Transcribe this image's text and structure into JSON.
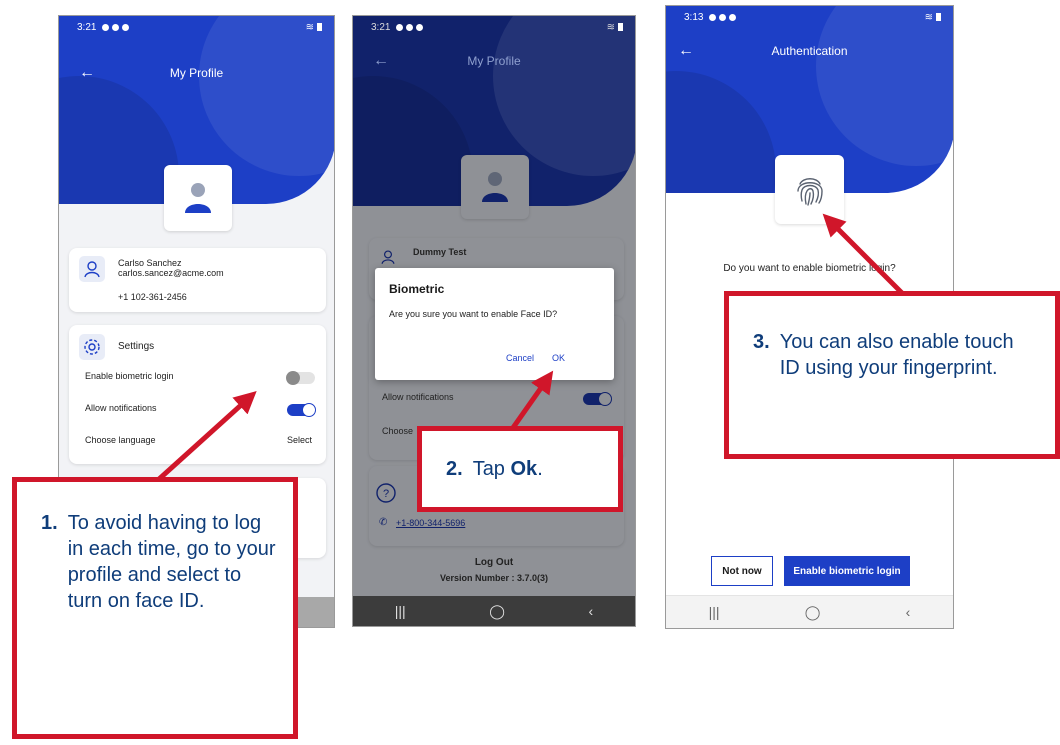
{
  "phone1": {
    "status": {
      "time": "3:21"
    },
    "title": "My Profile",
    "user": {
      "name": "Carlso Sanchez",
      "email": "carlos.sancez@acme.com",
      "phone": "+1 102-361-2456"
    },
    "settings": {
      "heading": "Settings",
      "biometric_label": "Enable biometric login",
      "notifications_label": "Allow notifications",
      "language_label": "Choose language",
      "language_value": "Select"
    }
  },
  "phone2": {
    "status": {
      "time": "3:21"
    },
    "title": "My Profile",
    "user_name": "Dummy Test",
    "dialog": {
      "title": "Biometric",
      "message": "Are you sure you want to enable Face ID?",
      "cancel": "Cancel",
      "ok": "OK"
    },
    "notifications_label": "Allow notifications",
    "choose_fragment": "Choose",
    "support_phone": "+1-800-344-5696",
    "logout": "Log Out",
    "version": "Version Number : 3.7.0(3)"
  },
  "phone3": {
    "status": {
      "time": "3:13"
    },
    "title": "Authentication",
    "question": "Do you want to enable biometric login?",
    "not_now": "Not now",
    "enable": "Enable biometric login"
  },
  "callouts": {
    "one": {
      "num": "1.",
      "text": "To avoid having to log in each time, go to your profile and select to turn on face ID."
    },
    "two": {
      "num": "2.",
      "pre": "Tap ",
      "bold": "Ok",
      "post": "."
    },
    "three": {
      "num": "3.",
      "text": "You can also enable touch ID using your fingerprint."
    }
  },
  "colors": {
    "brand_blue": "#1d3fc6",
    "callout_red": "#d0162a",
    "callout_text": "#0f3d7a"
  }
}
